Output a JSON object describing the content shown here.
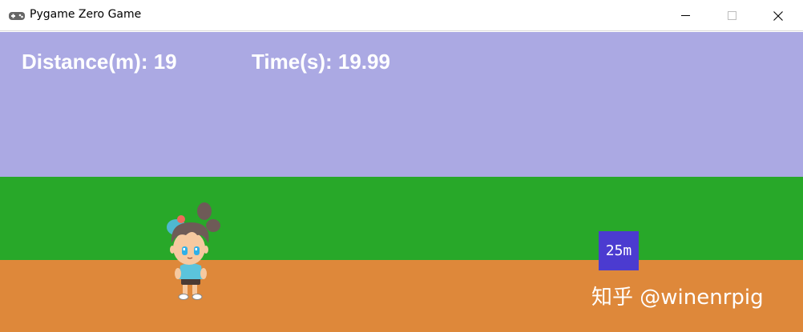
{
  "window": {
    "title": "Pygame Zero Game",
    "icon": "gamepad-icon",
    "controls": [
      "minimize-icon",
      "maximize-icon",
      "close-icon"
    ]
  },
  "hud": {
    "distance": "Distance(m): 19",
    "time": "Time(s): 19.99"
  },
  "marker": {
    "label": "25m"
  },
  "watermark": {
    "text": "知乎 @winenrpig"
  },
  "colors": {
    "sky": "#aba9e3",
    "grass": "#28a829",
    "dirt": "#de883a",
    "marker": "#4b3bd0",
    "hud_text": "#ffffff"
  }
}
